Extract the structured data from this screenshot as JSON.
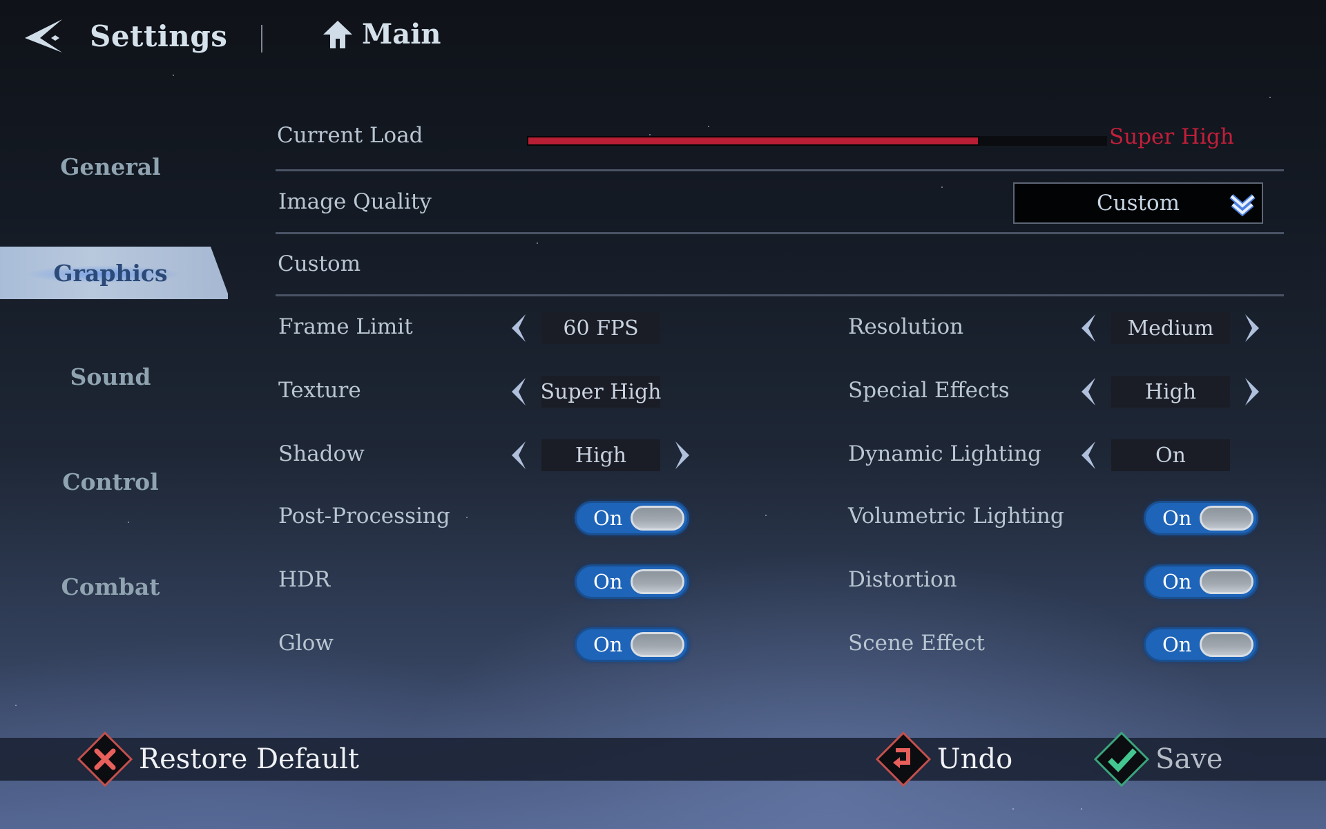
{
  "header": {
    "title": "Settings",
    "home_label": "Main"
  },
  "sidebar": {
    "items": [
      {
        "label": "General",
        "active": false
      },
      {
        "label": "Graphics",
        "active": true
      },
      {
        "label": "Sound",
        "active": false
      },
      {
        "label": "Control",
        "active": false
      },
      {
        "label": "Combat",
        "active": false
      }
    ]
  },
  "graphics": {
    "current_load": {
      "label": "Current Load",
      "value_label": "Super High",
      "fill_fraction": 0.78,
      "color": "#b81f35"
    },
    "image_quality": {
      "label": "Image Quality",
      "selected": "Custom"
    },
    "preset_label": "Custom",
    "selectors": [
      {
        "label": "Frame Limit",
        "value": "60 FPS",
        "has_prev": true,
        "has_next": false
      },
      {
        "label": "Resolution",
        "value": "Medium",
        "has_prev": true,
        "has_next": true
      },
      {
        "label": "Texture",
        "value": "Super High",
        "has_prev": true,
        "has_next": false
      },
      {
        "label": "Special Effects",
        "value": "High",
        "has_prev": true,
        "has_next": true
      },
      {
        "label": "Shadow",
        "value": "High",
        "has_prev": true,
        "has_next": true
      },
      {
        "label": "Dynamic Lighting",
        "value": "On",
        "has_prev": true,
        "has_next": false
      }
    ],
    "toggles": [
      {
        "label": "Post-Processing",
        "state": "On",
        "on": true
      },
      {
        "label": "Volumetric Lighting",
        "state": "On",
        "on": true
      },
      {
        "label": "HDR",
        "state": "On",
        "on": true
      },
      {
        "label": "Distortion",
        "state": "On",
        "on": true
      },
      {
        "label": "Glow",
        "state": "On",
        "on": true
      },
      {
        "label": "Scene Effect",
        "state": "On",
        "on": true
      }
    ]
  },
  "footer": {
    "restore_label": "Restore Default",
    "undo_label": "Undo",
    "save_label": "Save"
  },
  "colors": {
    "accent_blue": "#1e64b8",
    "danger": "#d9534f",
    "success": "#3fbf8a",
    "load_text": "#c21f3a"
  }
}
